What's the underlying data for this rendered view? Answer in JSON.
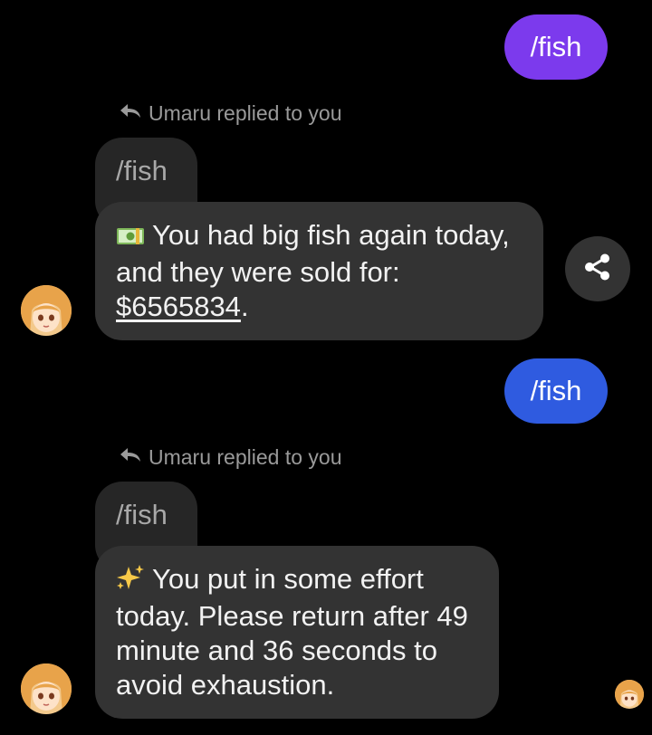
{
  "messages": {
    "sent1": {
      "text": "/fish",
      "color": "#7c3aed"
    },
    "sent2": {
      "text": "/fish",
      "color": "#2f5be0"
    },
    "reply1": {
      "header": "Umaru replied to you",
      "quoted": "/fish",
      "emoji_icon": "money-emoji-icon",
      "line1": "You had big fish again today,",
      "line2": "and they were sold for:",
      "amount": "$6565834",
      "period": "."
    },
    "reply2": {
      "header": "Umaru replied to you",
      "quoted": "/fish",
      "emoji_icon": "sparkles-emoji-icon",
      "line1": "You put in some effort",
      "line2": "today. Please return after 49",
      "line3": "minute and 36 seconds to",
      "line4": "avoid exhaustion."
    }
  },
  "icons": {
    "share": "share-icon",
    "reply_arrow": "reply-arrow-icon",
    "avatar": "umaru-avatar"
  },
  "colors": {
    "background": "#000000",
    "received_bubble": "#333333",
    "quoted_bubble": "#262626"
  }
}
